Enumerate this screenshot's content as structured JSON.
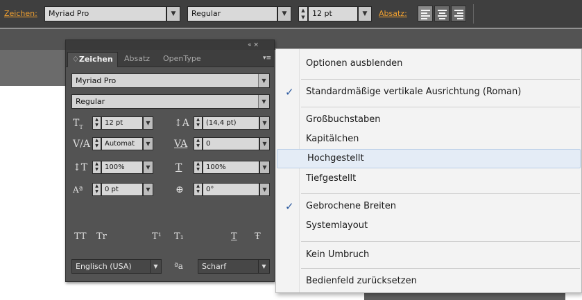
{
  "toolbar": {
    "zeichen_label": "Zeichen:",
    "font_family": "Myriad Pro",
    "font_style": "Regular",
    "font_size": "12 pt",
    "absatz_label": "Absatz:",
    "align_icons": [
      "align-left-icon",
      "align-center-icon",
      "align-right-icon"
    ]
  },
  "panel": {
    "controls": "« ×",
    "tabs": [
      "♢Zeichen",
      "Absatz",
      "OpenType"
    ],
    "menu_icon": "▾≡",
    "font_family": "Myriad Pro",
    "font_style": "Regular",
    "font_size": "12 pt",
    "leading": "(14,4 pt)",
    "kerning": "Automat",
    "tracking": "0",
    "vertical_scale": "100%",
    "horizontal_scale": "100%",
    "baseline_shift": "0 pt",
    "rotation": "0°",
    "format_buttons": [
      "TT",
      "Tr",
      "T¹",
      "T₁",
      "T",
      "Ŧ"
    ],
    "language": "Englisch (USA)",
    "aa_label": "ªa",
    "antialias": "Scharf"
  },
  "menu": {
    "items": [
      {
        "label": "Optionen ausblenden",
        "checked": false
      },
      {
        "label": "Standardmäßige vertikale Ausrichtung (Roman)",
        "checked": true
      },
      {
        "label": "Großbuchstaben",
        "checked": false
      },
      {
        "label": "Kapitälchen",
        "checked": false
      },
      {
        "label": "Hochgestellt",
        "checked": false,
        "highlighted": true
      },
      {
        "label": "Tiefgestellt",
        "checked": false
      },
      {
        "label": "Gebrochene Breiten",
        "checked": true
      },
      {
        "label": "Systemlayout",
        "checked": false
      },
      {
        "label": "Kein Umbruch",
        "checked": false
      },
      {
        "label": "Bedienfeld zurücksetzen",
        "checked": false
      }
    ],
    "checkmark": "✓"
  },
  "colors": {
    "toolbar_bg": "#3f3f3f",
    "label_accent": "#f0a030",
    "panel_bg": "#535353",
    "menu_bg": "#f3f3f3",
    "menu_highlight": "#e4ecf6",
    "check_color": "#2c5aa0"
  }
}
